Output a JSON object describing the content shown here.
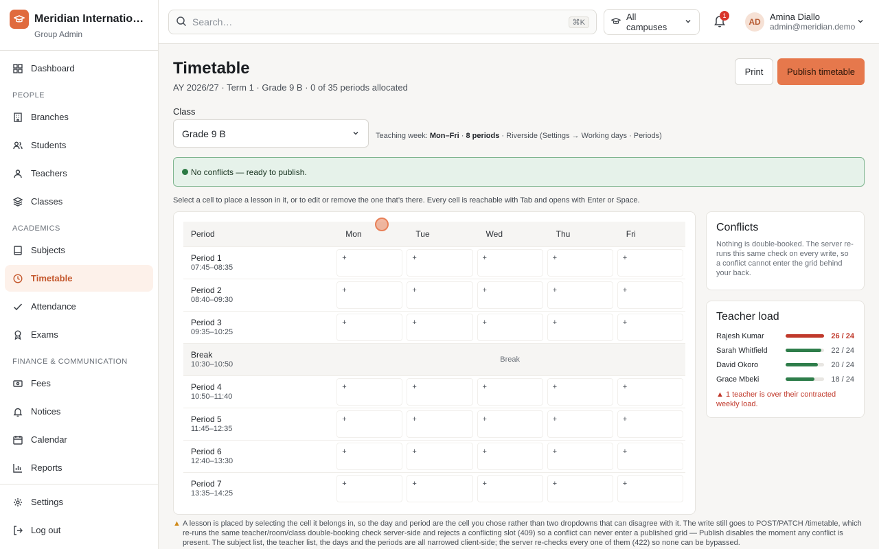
{
  "brand": {
    "name": "Meridian International …",
    "role": "Group Admin"
  },
  "nav": {
    "dashboard": "Dashboard",
    "section_people": "PEOPLE",
    "branches": "Branches",
    "students": "Students",
    "teachers": "Teachers",
    "classes": "Classes",
    "section_academics": "ACADEMICS",
    "subjects": "Subjects",
    "timetable": "Timetable",
    "attendance": "Attendance",
    "exams": "Exams",
    "section_finance": "FINANCE & COMMUNICATION",
    "fees": "Fees",
    "notices": "Notices",
    "calendar": "Calendar",
    "reports": "Reports",
    "settings": "Settings",
    "logout": "Log out"
  },
  "topbar": {
    "search_placeholder": "Search…",
    "search_shortcut": "⌘K",
    "campus": "All campuses",
    "notifications_count": "1",
    "user_initials": "AD",
    "user_name": "Amina Diallo",
    "user_email": "admin@meridian.demo"
  },
  "page": {
    "title": "Timetable",
    "subtitle": "AY 2026/27 · Term 1 · Grade 9 B · 0 of 35 periods allocated",
    "print": "Print",
    "publish": "Publish timetable",
    "class_label": "Class",
    "class_value": "Grade 9 B",
    "teaching_week_prefix": "Teaching week: ",
    "teaching_week_days": "Mon–Fri",
    "teaching_week_sep": " · ",
    "teaching_week_periods": "8 periods",
    "teaching_week_suffix": " · Riverside (Settings → Working days · Periods)",
    "status": "No conflicts — ready to publish.",
    "helper": "Select a cell to place a lesson in it, or to edit or remove the one that’s there. Every cell is reachable with Tab and opens with Enter or Space."
  },
  "grid": {
    "header_period": "Period",
    "days": [
      "Mon",
      "Tue",
      "Wed",
      "Thu",
      "Fri"
    ],
    "empty_cell": "+",
    "rows": [
      {
        "name": "Period 1",
        "time": "07:45–08:35",
        "is_break": false
      },
      {
        "name": "Period 2",
        "time": "08:40–09:30",
        "is_break": false
      },
      {
        "name": "Period 3",
        "time": "09:35–10:25",
        "is_break": false
      },
      {
        "name": "Break",
        "time": "10:30–10:50",
        "is_break": true,
        "label": "Break"
      },
      {
        "name": "Period 4",
        "time": "10:50–11:40",
        "is_break": false
      },
      {
        "name": "Period 5",
        "time": "11:45–12:35",
        "is_break": false
      },
      {
        "name": "Period 6",
        "time": "12:40–13:30",
        "is_break": false
      },
      {
        "name": "Period 7",
        "time": "13:35–14:25",
        "is_break": false
      }
    ]
  },
  "conflicts": {
    "title": "Conflicts",
    "text": "Nothing is double-booked. The server re-runs this same check on every write, so a conflict cannot enter the grid behind your back."
  },
  "teacher_load": {
    "title": "Teacher load",
    "teachers": [
      {
        "name": "Rajesh Kumar",
        "load": 26,
        "max": 24,
        "label": "26 / 24",
        "over": true
      },
      {
        "name": "Sarah Whitfield",
        "load": 22,
        "max": 24,
        "label": "22 / 24",
        "over": false
      },
      {
        "name": "David Okoro",
        "load": 20,
        "max": 24,
        "label": "20 / 24",
        "over": false
      },
      {
        "name": "Grace Mbeki",
        "load": 18,
        "max": 24,
        "label": "18 / 24",
        "over": false
      }
    ],
    "warning": "▲ 1 teacher is over their contracted weekly load."
  },
  "footnote": "A lesson is placed by selecting the cell it belongs in, so the day and period are the cell you chose rather than two dropdowns that can disagree with it. The write still goes to POST/PATCH /timetable, which re-runs the same teacher/room/class double-booking check server-side and rejects a conflicting slot (409) so a conflict can never enter a published grid — Publish disables the moment any conflict is present. The subject list, the teacher list, the days and the periods are all narrowed client-side; the server re-checks every one of them (422) so none can be bypassed.",
  "colors": {
    "accent": "#e6784c",
    "active_nav_bg": "#fdf1ea",
    "success": "#2b7a44",
    "danger": "#c0392b"
  }
}
